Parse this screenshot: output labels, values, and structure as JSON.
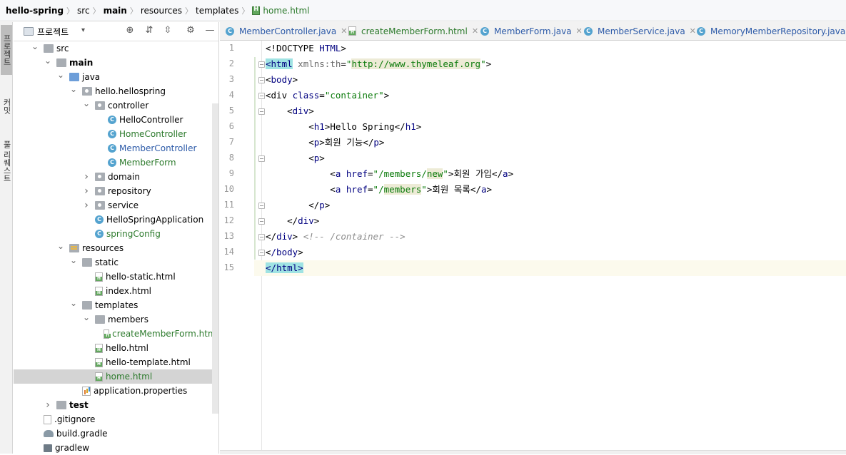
{
  "breadcrumb": [
    "hello-spring",
    "src",
    "main",
    "resources",
    "templates",
    "home.html"
  ],
  "toolstrip": [
    "프로젝트",
    "커밋",
    "풀 리퀘스트"
  ],
  "project_panel": {
    "title": "프로젝트"
  },
  "tree": [
    {
      "label": "src",
      "depth": 0,
      "arrow": "open",
      "icon": "folder"
    },
    {
      "label": "main",
      "depth": 1,
      "arrow": "open",
      "icon": "folder",
      "style": "bold"
    },
    {
      "label": "java",
      "depth": 2,
      "arrow": "open",
      "icon": "folder-blue"
    },
    {
      "label": "hello.hellospring",
      "depth": 3,
      "arrow": "open",
      "icon": "package"
    },
    {
      "label": "controller",
      "depth": 4,
      "arrow": "open",
      "icon": "package"
    },
    {
      "label": "HelloController",
      "depth": 5,
      "arrow": "",
      "icon": "class"
    },
    {
      "label": "HomeController",
      "depth": 5,
      "arrow": "",
      "icon": "class",
      "style": "green"
    },
    {
      "label": "MemberController",
      "depth": 5,
      "arrow": "",
      "icon": "class",
      "style": "blue"
    },
    {
      "label": "MemberForm",
      "depth": 5,
      "arrow": "",
      "icon": "class",
      "style": "green"
    },
    {
      "label": "domain",
      "depth": 4,
      "arrow": "closed",
      "icon": "package"
    },
    {
      "label": "repository",
      "depth": 4,
      "arrow": "closed",
      "icon": "package"
    },
    {
      "label": "service",
      "depth": 4,
      "arrow": "closed",
      "icon": "package"
    },
    {
      "label": "HelloSpringApplication",
      "depth": 4,
      "arrow": "",
      "icon": "class"
    },
    {
      "label": "springConfig",
      "depth": 4,
      "arrow": "",
      "icon": "class",
      "style": "green"
    },
    {
      "label": "resources",
      "depth": 2,
      "arrow": "open",
      "icon": "folder-res"
    },
    {
      "label": "static",
      "depth": 3,
      "arrow": "open",
      "icon": "folder"
    },
    {
      "label": "hello-static.html",
      "depth": 4,
      "arrow": "",
      "icon": "html"
    },
    {
      "label": "index.html",
      "depth": 4,
      "arrow": "",
      "icon": "html"
    },
    {
      "label": "templates",
      "depth": 3,
      "arrow": "open",
      "icon": "folder"
    },
    {
      "label": "members",
      "depth": 4,
      "arrow": "open",
      "icon": "folder"
    },
    {
      "label": "createMemberForm.html",
      "depth": 5,
      "arrow": "",
      "icon": "html",
      "style": "green"
    },
    {
      "label": "hello.html",
      "depth": 4,
      "arrow": "",
      "icon": "html"
    },
    {
      "label": "hello-template.html",
      "depth": 4,
      "arrow": "",
      "icon": "html"
    },
    {
      "label": "home.html",
      "depth": 4,
      "arrow": "",
      "icon": "html",
      "style": "green",
      "selected": true
    },
    {
      "label": "application.properties",
      "depth": 3,
      "arrow": "",
      "icon": "props"
    },
    {
      "label": "test",
      "depth": 1,
      "arrow": "closed",
      "icon": "folder",
      "style": "bold"
    },
    {
      "label": ".gitignore",
      "depth": 0,
      "arrow": "",
      "icon": "git"
    },
    {
      "label": "build.gradle",
      "depth": 0,
      "arrow": "",
      "icon": "gradle"
    },
    {
      "label": "gradlew",
      "depth": 0,
      "arrow": "",
      "icon": "term"
    }
  ],
  "tabs": [
    {
      "label": "MemberController.java",
      "kind": "class"
    },
    {
      "label": "createMemberForm.html",
      "kind": "html"
    },
    {
      "label": "MemberForm.java",
      "kind": "class"
    },
    {
      "label": "MemberService.java",
      "kind": "class"
    },
    {
      "label": "MemoryMemberRepository.java",
      "kind": "class"
    }
  ],
  "editor": {
    "line_numbers": [
      "1",
      "2",
      "3",
      "4",
      "5",
      "6",
      "7",
      "8",
      "9",
      "10",
      "11",
      "12",
      "13",
      "14",
      "15"
    ],
    "current_line": 15,
    "lines": [
      [
        {
          "t": "<!DOCTYPE ",
          "c": ""
        },
        {
          "t": "HTML",
          "c": "tag"
        },
        {
          "t": ">",
          "c": ""
        }
      ],
      [
        {
          "t": "<",
          "c": "tag-hl-lt"
        },
        {
          "t": "html",
          "c": "tag-hl"
        },
        {
          "t": " ",
          "c": ""
        },
        {
          "t": "xmlns:th",
          "c": "attr"
        },
        {
          "t": "=",
          "c": ""
        },
        {
          "t": "\"",
          "c": "str"
        },
        {
          "t": "http://www.thymeleaf.org",
          "c": "str-hl"
        },
        {
          "t": "\"",
          "c": "str"
        },
        {
          "t": ">",
          "c": ""
        }
      ],
      [
        {
          "t": "<",
          "c": ""
        },
        {
          "t": "body",
          "c": "tag"
        },
        {
          "t": ">",
          "c": ""
        }
      ],
      [
        {
          "t": "<div ",
          "c": ""
        },
        {
          "t": "class",
          "c": "tag"
        },
        {
          "t": "=",
          "c": ""
        },
        {
          "t": "\"container\"",
          "c": "str"
        },
        {
          "t": ">",
          "c": ""
        }
      ],
      [
        {
          "t": "    <",
          "c": ""
        },
        {
          "t": "div",
          "c": "tag"
        },
        {
          "t": ">",
          "c": ""
        }
      ],
      [
        {
          "t": "        <",
          "c": ""
        },
        {
          "t": "h1",
          "c": "tag"
        },
        {
          "t": ">Hello Spring</",
          "c": ""
        },
        {
          "t": "h1",
          "c": "tag"
        },
        {
          "t": ">",
          "c": ""
        }
      ],
      [
        {
          "t": "        <",
          "c": ""
        },
        {
          "t": "p",
          "c": "tag"
        },
        {
          "t": ">회원 기능</",
          "c": ""
        },
        {
          "t": "p",
          "c": "tag"
        },
        {
          "t": ">",
          "c": ""
        }
      ],
      [
        {
          "t": "        <",
          "c": ""
        },
        {
          "t": "p",
          "c": "tag"
        },
        {
          "t": ">",
          "c": ""
        }
      ],
      [
        {
          "t": "            <",
          "c": ""
        },
        {
          "t": "a",
          "c": "tag"
        },
        {
          "t": " ",
          "c": ""
        },
        {
          "t": "href",
          "c": "tag"
        },
        {
          "t": "=",
          "c": ""
        },
        {
          "t": "\"/members/",
          "c": "str"
        },
        {
          "t": "new",
          "c": "str-hl"
        },
        {
          "t": "\"",
          "c": "str"
        },
        {
          "t": ">회원 가입</",
          "c": ""
        },
        {
          "t": "a",
          "c": "tag"
        },
        {
          "t": ">",
          "c": ""
        }
      ],
      [
        {
          "t": "            <",
          "c": ""
        },
        {
          "t": "a",
          "c": "tag"
        },
        {
          "t": " ",
          "c": ""
        },
        {
          "t": "href",
          "c": "tag"
        },
        {
          "t": "=",
          "c": ""
        },
        {
          "t": "\"/",
          "c": "str"
        },
        {
          "t": "members",
          "c": "str-hl"
        },
        {
          "t": "\"",
          "c": "str"
        },
        {
          "t": ">회원 목록</",
          "c": ""
        },
        {
          "t": "a",
          "c": "tag"
        },
        {
          "t": ">",
          "c": ""
        }
      ],
      [
        {
          "t": "        </",
          "c": ""
        },
        {
          "t": "p",
          "c": "tag"
        },
        {
          "t": ">",
          "c": ""
        }
      ],
      [
        {
          "t": "    </",
          "c": ""
        },
        {
          "t": "div",
          "c": "tag"
        },
        {
          "t": ">",
          "c": ""
        }
      ],
      [
        {
          "t": "</",
          "c": ""
        },
        {
          "t": "div",
          "c": "tag"
        },
        {
          "t": "> ",
          "c": ""
        },
        {
          "t": "<!-- /container -->",
          "c": "cmt"
        }
      ],
      [
        {
          "t": "<",
          "c": ""
        },
        {
          "t": "/body",
          "c": "tag"
        },
        {
          "t": ">",
          "c": ""
        }
      ],
      [
        {
          "t": "</",
          "c": "tag-hl"
        },
        {
          "t": "html",
          "c": "tag-hl"
        },
        {
          "t": ">",
          "c": "tag-hl"
        }
      ]
    ]
  },
  "colors": {
    "accent_green": "#2c7a2c",
    "accent_blue": "#2c5aa8",
    "selection": "#d4d4d4"
  }
}
